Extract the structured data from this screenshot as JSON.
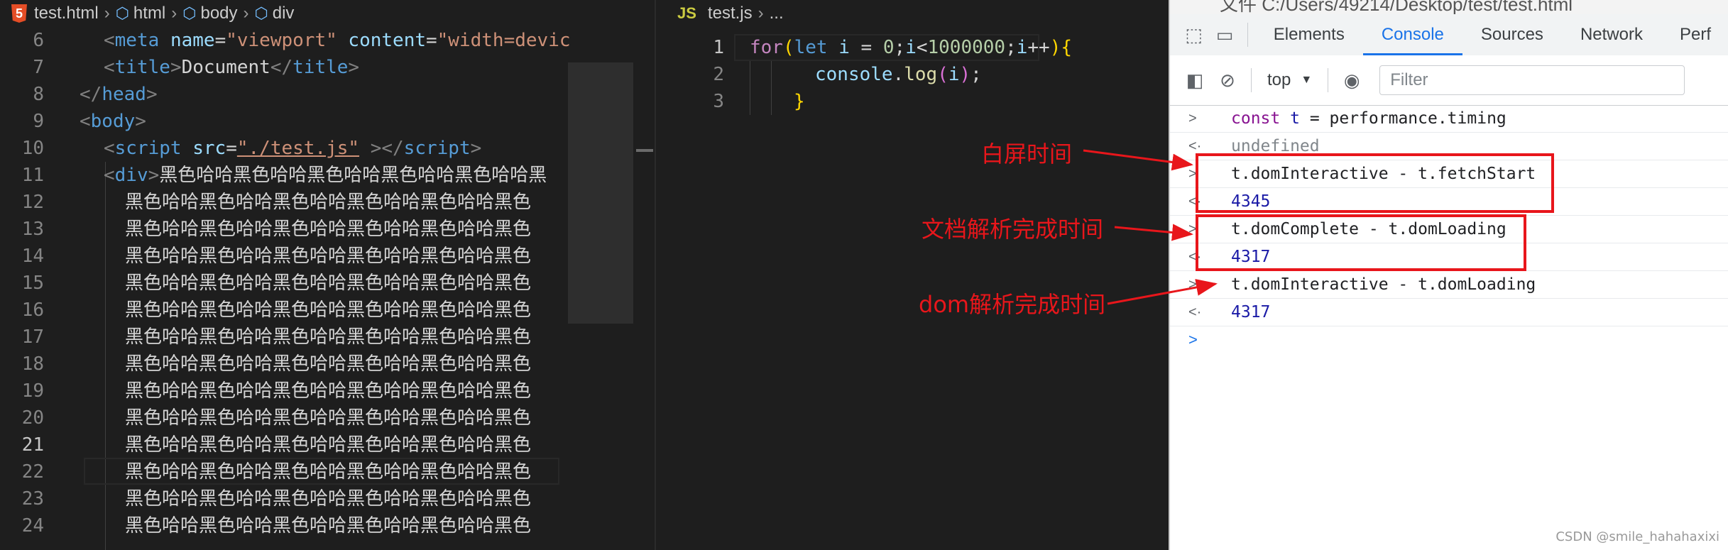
{
  "left_editor": {
    "file": "test.html",
    "breadcrumb": [
      "html",
      "body",
      "div"
    ],
    "lines": [
      {
        "n": "6"
      },
      {
        "n": "7"
      },
      {
        "n": "8"
      },
      {
        "n": "9"
      },
      {
        "n": "10"
      },
      {
        "n": "11"
      },
      {
        "n": "12"
      },
      {
        "n": "13"
      },
      {
        "n": "14"
      },
      {
        "n": "15"
      },
      {
        "n": "16"
      },
      {
        "n": "17"
      },
      {
        "n": "18"
      },
      {
        "n": "19"
      },
      {
        "n": "20"
      },
      {
        "n": "21"
      },
      {
        "n": "22"
      },
      {
        "n": "23"
      },
      {
        "n": "24"
      }
    ],
    "line6": {
      "open": "<",
      "tag": "meta",
      "attr1": "name",
      "eq": "=",
      "val1": "\"viewport\"",
      "attr2": "content",
      "val2": "\"width=devic"
    },
    "line7": {
      "open": "<",
      "tag": "title",
      "close": ">",
      "text": "Document",
      "endopen": "</",
      "endclose": ">"
    },
    "line8": {
      "open": "</",
      "tag": "head",
      "close": ">"
    },
    "line9": {
      "open": "<",
      "tag": "body",
      "close": ">"
    },
    "line10": {
      "open": "<",
      "tag": "script",
      "attr": "src",
      "val": "\"./test.js\"",
      "close": "></",
      "endclose": ">"
    },
    "line11": {
      "open": "<",
      "tag": "div",
      "close": ">",
      "text": "黑色哈哈黑色哈哈黑色哈哈黑色哈哈黑色哈哈黑"
    },
    "repeat_text": "黑色哈哈黑色哈哈黑色哈哈黑色哈哈黑色哈哈黑色"
  },
  "mid_editor": {
    "file": "test.js",
    "breadcrumb_more": "...",
    "lines": [
      {
        "n": "1"
      },
      {
        "n": "2"
      },
      {
        "n": "3"
      }
    ],
    "l1": {
      "kw_for": "for",
      "p1": "(",
      "kw_let": "let",
      "var_i": "i",
      "eq": " = ",
      "zero": "0",
      "semi1": ";",
      "i2": "i",
      "lt": "<",
      "big": "1000000",
      "semi2": ";",
      "i3": "i",
      "inc": "++",
      "p2": ")",
      "brace": "{"
    },
    "l2": {
      "obj": "console",
      "dot": ".",
      "fn": "log",
      "p1": "(",
      "arg": "i",
      "p2": ")",
      "semi": ";"
    },
    "l3": {
      "brace": "}"
    }
  },
  "annotations": {
    "white_screen": "白屏时间",
    "doc_parse": "文档解析完成时间",
    "dom_parse": "dom解析完成时间"
  },
  "devtools": {
    "path": "文件   C:/Users/49214/Desktop/test/test.html",
    "tabs": [
      "Elements",
      "Console",
      "Sources",
      "Network",
      "Perf"
    ],
    "active_tab": "Console",
    "context": "top",
    "filter_placeholder": "Filter",
    "console": {
      "r1_kw": "const",
      "r1_var": "t",
      "r1_rest": " = performance.timing",
      "r2": "undefined",
      "r3": "t.domInteractive - t.fetchStart",
      "r4": "4345",
      "r5": "t.domComplete - t.domLoading",
      "r6": "4317",
      "r7": "t.domInteractive - t.domLoading",
      "r8": "4317"
    },
    "chevron_in": ">",
    "chevron_out": "<·"
  },
  "watermark": "CSDN @smile_hahahaxixi",
  "colors": {
    "annotation_red": "#e8161b",
    "devtools_accent": "#1a73e8"
  }
}
